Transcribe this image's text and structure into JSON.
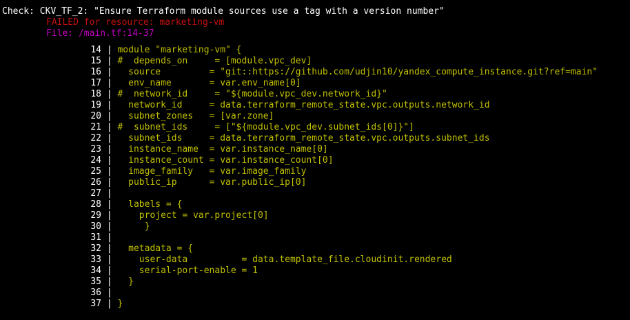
{
  "header": {
    "check_prefix": "Check: ",
    "check_id": "CKV_TF_2",
    "check_text": ": \"Ensure Terraform module sources use a tag with a version number\"",
    "failed_text": "FAILED for resource: marketing-vm",
    "file_text": "File: /main.tf:14-37"
  },
  "colors": {
    "background": "#000000",
    "check": "#ffffff",
    "failed": "#c01010",
    "file": "#c000c0",
    "code": "#c0c000",
    "line_numbers": "#ffffff"
  },
  "code_lines": [
    {
      "num": "14",
      "text": "module \"marketing-vm\" {"
    },
    {
      "num": "15",
      "text": "#  depends_on     = [module.vpc_dev]"
    },
    {
      "num": "16",
      "text": "  source         = \"git::https://github.com/udjin10/yandex_compute_instance.git?ref=main\""
    },
    {
      "num": "17",
      "text": "  env_name       = var.env_name[0]"
    },
    {
      "num": "18",
      "text": "#  network_id     = \"${module.vpc_dev.network_id}\""
    },
    {
      "num": "19",
      "text": "  network_id     = data.terraform_remote_state.vpc.outputs.network_id"
    },
    {
      "num": "20",
      "text": "  subnet_zones   = [var.zone]"
    },
    {
      "num": "21",
      "text": "#  subnet_ids     = [\"${module.vpc_dev.subnet_ids[0]}\"]"
    },
    {
      "num": "22",
      "text": "  subnet_ids     = data.terraform_remote_state.vpc.outputs.subnet_ids"
    },
    {
      "num": "23",
      "text": "  instance_name  = var.instance_name[0]"
    },
    {
      "num": "24",
      "text": "  instance_count = var.instance_count[0]"
    },
    {
      "num": "25",
      "text": "  image_family   = var.image_family"
    },
    {
      "num": "26",
      "text": "  public_ip      = var.public_ip[0]"
    },
    {
      "num": "27",
      "text": ""
    },
    {
      "num": "28",
      "text": "  labels = {"
    },
    {
      "num": "29",
      "text": "    project = var.project[0]"
    },
    {
      "num": "30",
      "text": "     }"
    },
    {
      "num": "31",
      "text": ""
    },
    {
      "num": "32",
      "text": "  metadata = {"
    },
    {
      "num": "33",
      "text": "    user-data          = data.template_file.cloudinit.rendered"
    },
    {
      "num": "34",
      "text": "    serial-port-enable = 1"
    },
    {
      "num": "35",
      "text": "  }"
    },
    {
      "num": "36",
      "text": ""
    },
    {
      "num": "37",
      "text": "}"
    }
  ]
}
